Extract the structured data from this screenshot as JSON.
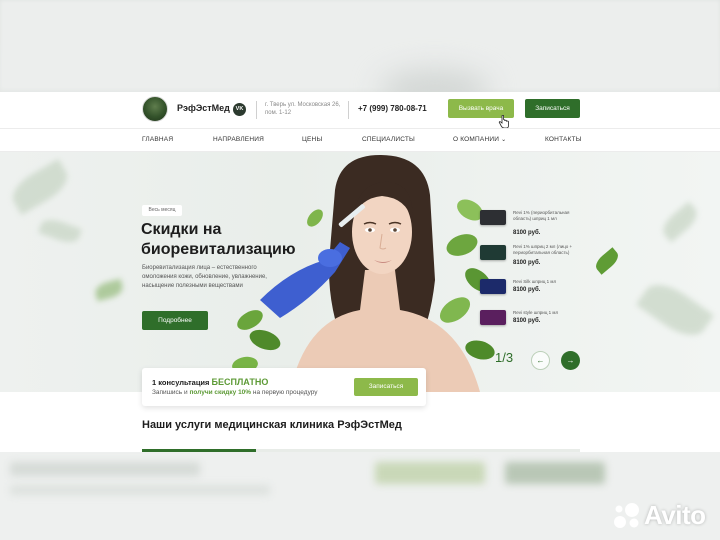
{
  "header": {
    "brand": "РэфЭстМед",
    "social": "VK",
    "address": "г. Тверь ул. Московская 26, пом. 1-12",
    "phone": "+7 (999) 780-08-71",
    "call_doctor_label": "Вызвать врача",
    "book_label": "Записаться"
  },
  "nav": {
    "items": [
      "ГЛАВНАЯ",
      "НАПРАВЛЕНИЯ",
      "ЦЕНЫ",
      "СПЕЦИАЛИСТЫ",
      "О КОМПАНИИ",
      "КОНТАКТЫ"
    ]
  },
  "hero": {
    "badge": "Весь месяц",
    "title": "Скидки на биоревитализацию",
    "description": "Биоревитализация лица – естественного омоложения кожи, обновление, увлажнение, насыщение полезными веществами",
    "more_label": "Подробнее",
    "slide_counter": "1/3"
  },
  "products": [
    {
      "name": "Revi 1% (периорбитальная область) шприц 1 мл",
      "price": "8100 руб.",
      "color": "#2d2f33"
    },
    {
      "name": "Revi 1% шприц 2 мл (лицо + периорбитальная область)",
      "price": "8100 руб.",
      "color": "#1f3a34"
    },
    {
      "name": "Revi Silk шприц 1 мл",
      "price": "8100 руб.",
      "color": "#1c2a6a"
    },
    {
      "name": "Revi style шприц 1 мл",
      "price": "8100 руб.",
      "color": "#5a1f5e"
    }
  ],
  "promo": {
    "line1_prefix": "1 консультация",
    "line1_free": "БЕСПЛАТНО",
    "line2_prefix": "Запишись и",
    "line2_bold": "получи скидку 10%",
    "line2_suffix": "на первую процедуру",
    "button_label": "Записаться"
  },
  "services": {
    "title": "Наши услуги медицинская клиника РэфЭстМед"
  },
  "watermark": {
    "text": "Avito"
  },
  "colors": {
    "primary": "#2f6e2a",
    "accent": "#8db94a",
    "text": "#1d1d1d"
  }
}
